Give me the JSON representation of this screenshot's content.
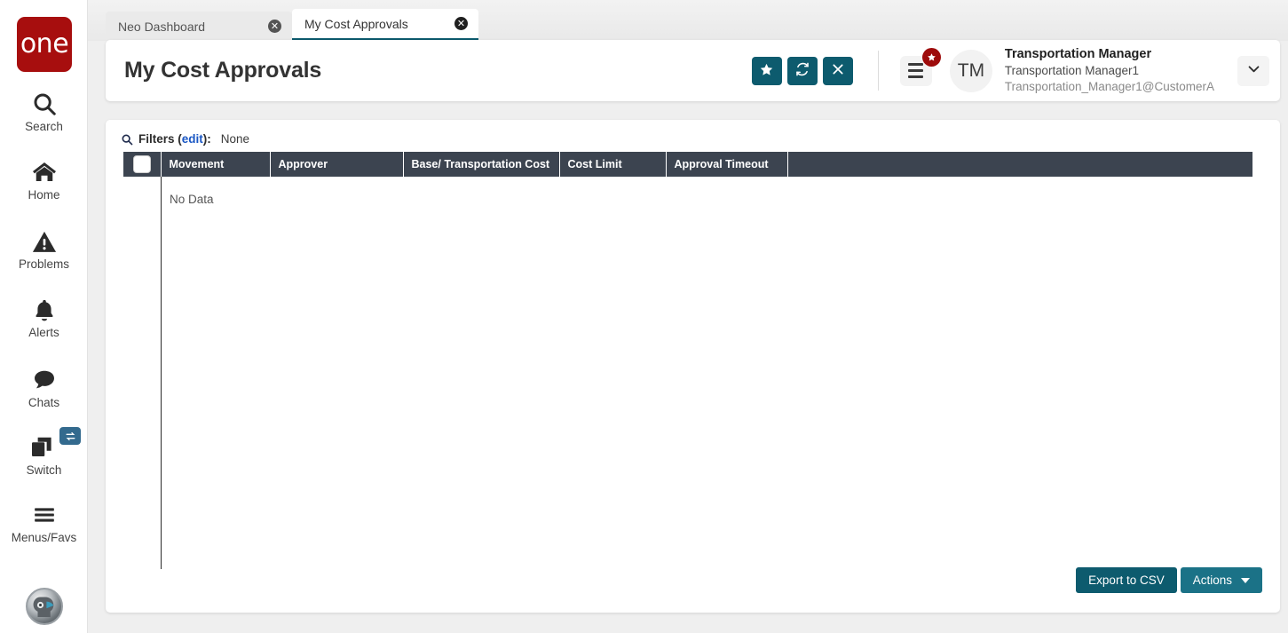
{
  "brand": {
    "logo_text": "one",
    "logo_color": "#a70e0e"
  },
  "theme": {
    "accent": "#0d5b6e",
    "accent_light": "#1b7287",
    "header_row": "#3c4450",
    "link": "#1a57c4"
  },
  "sidebar": {
    "items": [
      {
        "label": "Search",
        "icon": "search-icon"
      },
      {
        "label": "Home",
        "icon": "home-icon"
      },
      {
        "label": "Problems",
        "icon": "warning-triangle-icon"
      },
      {
        "label": "Alerts",
        "icon": "bell-icon"
      },
      {
        "label": "Chats",
        "icon": "chat-bubble-icon"
      },
      {
        "label": "Switch",
        "icon": "switch-windows-icon"
      },
      {
        "label": "Menus/Favs",
        "icon": "hamburger-icon"
      }
    ]
  },
  "tabs": [
    {
      "label": "Neo Dashboard",
      "active": false,
      "close": "✕"
    },
    {
      "label": "My Cost Approvals",
      "active": true,
      "close": "✕"
    }
  ],
  "header": {
    "title": "My Cost Approvals",
    "actions": [
      {
        "name": "favorite-button",
        "icon": "star-icon"
      },
      {
        "name": "refresh-button",
        "icon": "refresh-icon"
      },
      {
        "name": "close-button",
        "icon": "close-x-icon"
      }
    ],
    "menu_badge_icon": "star-icon",
    "user": {
      "initials": "TM",
      "role": "Transportation Manager",
      "name": "Transportation Manager1",
      "email": "Transportation_Manager1@CustomerA"
    }
  },
  "filters": {
    "icon": "search-icon",
    "label": "Filters",
    "edit_link": "edit",
    "colon": "):",
    "open_paren": " (",
    "value": "None"
  },
  "table": {
    "columns": [
      "Movement",
      "Approver",
      "Base/ Transportation Cost",
      "Cost Limit",
      "Approval Timeout"
    ],
    "rows": [],
    "empty_text": "No Data"
  },
  "footer": {
    "export_label": "Export to CSV",
    "actions_label": "Actions"
  }
}
